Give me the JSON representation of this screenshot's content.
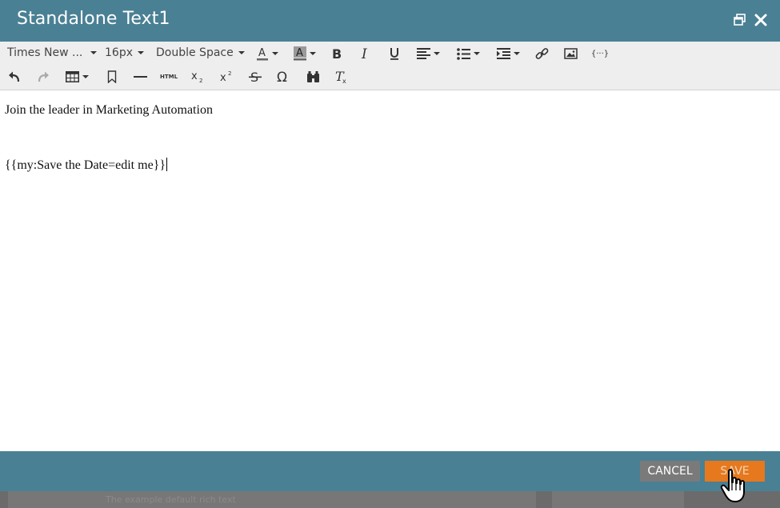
{
  "window": {
    "title": "Standalone Text1",
    "restore_icon": "restore-window-icon",
    "close_icon": "close-icon"
  },
  "toolbar": {
    "font_family": "Times New ...",
    "font_size": "16px",
    "line_spacing": "Double Space",
    "row1_icons": [
      "text-color-icon",
      "background-color-icon",
      "bold-icon",
      "italic-icon",
      "underline-icon",
      "align-icon",
      "bulleted-list-icon",
      "indent-icon",
      "link-icon",
      "image-icon",
      "tokens-icon"
    ],
    "row2_icons": [
      "undo-icon",
      "redo-icon",
      "table-icon",
      "bookmark-icon",
      "horizontal-rule-icon",
      "html-icon",
      "subscript-icon",
      "superscript-icon",
      "strikethrough-icon",
      "special-character-icon",
      "find-icon",
      "clear-formatting-icon"
    ],
    "html_label": "HTML",
    "tokens_label": "{···}"
  },
  "editor": {
    "line1": "Join the leader in Marketing Automation",
    "line2": "{{my:Save the Date=edit me}}"
  },
  "footer": {
    "cancel_label": "CANCEL",
    "save_label": "SAVE"
  },
  "backdrop": {
    "ghost_text": "The example default rich text"
  },
  "colors": {
    "header": "#4a8094",
    "toolbar": "#eeeeee",
    "cancel": "#7a7a7a",
    "save": "#e6781e"
  }
}
